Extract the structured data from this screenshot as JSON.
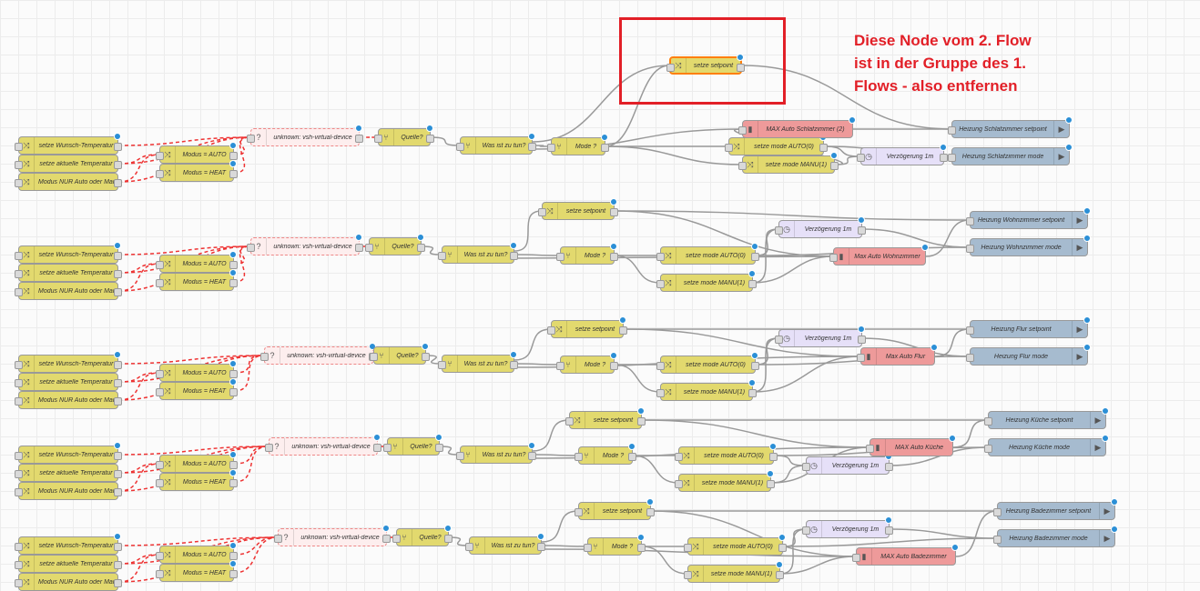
{
  "annotation": {
    "lines": [
      "Diese Node vom 2. Flow",
      "ist in der Gruppe des 1.",
      "Flows - also entfernen"
    ]
  },
  "colors": {
    "function": "#e2d96e",
    "output": "#ee9a9a",
    "delay": "#e6e0f8",
    "link": "#a6bbcf",
    "annotation": "#e21f27",
    "selection": "#ff7f0e"
  },
  "highlighted_node": "setze setpoint",
  "flows": [
    {
      "inputs": [
        "setze Wunsch-Temperatur",
        "setze aktuelle Temperatur",
        "Modus NUR Auto oder Manuell"
      ],
      "modes": [
        "Modus = AUTO",
        "Modus = HEAT"
      ],
      "device": "unknown: vsh-virtual-device",
      "source": "Quelle?",
      "switch": "Was ist zu tun?",
      "mode": "Mode ?",
      "setpoint": "",
      "auto": "setze mode AUTO(0)",
      "manu": "setze mode MANU(1)",
      "delay": "Verzögerung 1m",
      "max": "MAX Auto Schlafzimmer (2)",
      "out_setpoint": "Heizung Schlafzimmer setpoint",
      "out_mode": "Heizung Schlafzimmer mode"
    },
    {
      "inputs": [
        "setze Wunsch-Temperatur",
        "setze aktuelle Temperatur",
        "Modus NUR Auto oder Manuell"
      ],
      "modes": [
        "Modus = AUTO",
        "Modus = HEAT"
      ],
      "device": "unknown: vsh-virtual-device",
      "source": "Quelle?",
      "switch": "Was ist zu tun?",
      "mode": "Mode ?",
      "setpoint": "setze setpoint",
      "auto": "setze mode AUTO(0)",
      "manu": "setze mode MANU(1)",
      "delay": "Verzögerung 1m",
      "max": "Max Auto Wohnzimmer",
      "out_setpoint": "Heizung Wohnzimmer setpoint",
      "out_mode": "Heizung Wohnzimmer mode"
    },
    {
      "inputs": [
        "setze Wunsch-Temperatur",
        "setze aktuelle Temperatur",
        "Modus NUR Auto oder Manuell"
      ],
      "modes": [
        "Modus = AUTO",
        "Modus = HEAT"
      ],
      "device": "unknown: vsh-virtual-device",
      "source": "Quelle?",
      "switch": "Was ist zu tun?",
      "mode": "Mode ?",
      "setpoint": "setze setpoint",
      "auto": "setze mode AUTO(0)",
      "manu": "setze mode MANU(1)",
      "delay": "Verzögerung 1m",
      "max": "Max Auto Flur",
      "out_setpoint": "Heizung Flur setpoint",
      "out_mode": "Heizung Flur mode"
    },
    {
      "inputs": [
        "setze Wunsch-Temperatur",
        "setze aktuelle Temperatur",
        "Modus NUR Auto oder Manuell"
      ],
      "modes": [
        "Modus = AUTO",
        "Modus = HEAT"
      ],
      "device": "unknown: vsh-virtual-device",
      "source": "Quelle?",
      "switch": "Was ist zu tun?",
      "mode": "Mode ?",
      "setpoint": "setze setpoint",
      "auto": "setze mode AUTO(0)",
      "manu": "setze mode MANU(1)",
      "delay": "Verzögerung 1m",
      "max": "MAX Auto Küche",
      "out_setpoint": "Heizung Küche setpoint",
      "out_mode": "Heizung Küche mode"
    },
    {
      "inputs": [
        "setze Wunsch-Temperatur",
        "setze aktuelle Temperatur",
        "Modus NUR Auto oder Manuell"
      ],
      "modes": [
        "Modus = AUTO",
        "Modus = HEAT"
      ],
      "device": "unknown: vsh-virtual-device",
      "source": "Quelle?",
      "switch": "Was ist zu tun?",
      "mode": "Mode ?",
      "setpoint": "setze setpoint",
      "auto": "setze mode AUTO(0)",
      "manu": "setze mode MANU(1)",
      "delay": "Verzögerung 1m",
      "max": "MAX Auto Badezimmer",
      "out_setpoint": "Heizung Badezimmer setpoint",
      "out_mode": "Heizung Badezimmer mode"
    }
  ]
}
